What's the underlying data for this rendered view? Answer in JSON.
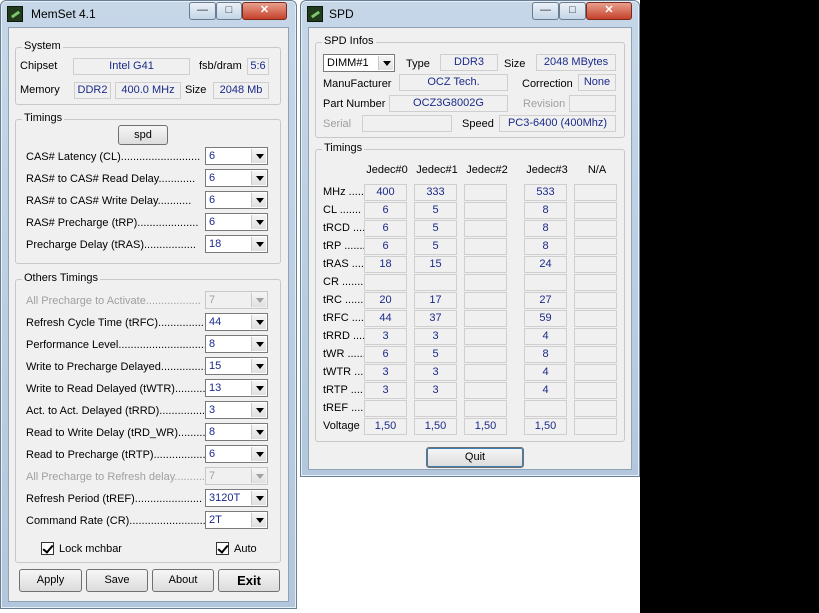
{
  "memset": {
    "title": "MemSet 4.1",
    "buttons": {
      "minimize": "—",
      "maximize": "□",
      "close": "✕"
    },
    "system": {
      "group_label": "System",
      "chipset_label": "Chipset",
      "chipset_value": "Intel G41",
      "fsb_label": "fsb/dram",
      "fsb_value": "5:6",
      "memory_label": "Memory",
      "memory_type": "DDR2",
      "memory_freq": "400.0 MHz",
      "size_label": "Size",
      "size_value": "2048 Mb"
    },
    "timings": {
      "group_label": "Timings",
      "spd_button": "spd",
      "rows": [
        {
          "label": "CAS# Latency (CL)..........................",
          "value": "6"
        },
        {
          "label": "RAS# to CAS# Read Delay............",
          "value": "6"
        },
        {
          "label": "RAS# to CAS# Write Delay...........",
          "value": "6"
        },
        {
          "label": "RAS# Precharge (tRP)....................",
          "value": "6"
        },
        {
          "label": "Precharge Delay  (tRAS).................",
          "value": "18"
        }
      ]
    },
    "others": {
      "group_label": "Others Timings",
      "rows": [
        {
          "label": "All Precharge to Activate..................",
          "value": "7",
          "disabled": true
        },
        {
          "label": "Refresh Cycle Time (tRFC)...............",
          "value": "44",
          "disabled": false
        },
        {
          "label": "Performance Level..............................",
          "value": "8",
          "disabled": false
        },
        {
          "label": "Write to Precharge Delayed...............",
          "value": "15",
          "disabled": false
        },
        {
          "label": "Write to Read Delayed (tWTR)...........",
          "value": "13",
          "disabled": false
        },
        {
          "label": "Act. to Act. Delayed (tRRD)...............",
          "value": "3",
          "disabled": false
        },
        {
          "label": "Read to Write Delay (tRD_WR)...........",
          "value": "8",
          "disabled": false
        },
        {
          "label": "Read to Precharge (tRTP)..................",
          "value": "6",
          "disabled": false
        },
        {
          "label": "All Precharge to Refresh delay............",
          "value": "7",
          "disabled": true
        },
        {
          "label": "Refresh Period (tREF)......................",
          "value": "3120T",
          "disabled": false
        },
        {
          "label": "Command Rate (CR)..........................",
          "value": "2T",
          "disabled": false
        }
      ],
      "lock_label": "Lock mchbar",
      "auto_label": "Auto"
    },
    "footer": {
      "apply": "Apply",
      "save": "Save",
      "about": "About",
      "exit": "Exit"
    }
  },
  "spd": {
    "title": "SPD",
    "buttons": {
      "minimize": "—",
      "maximize": "□",
      "close": "✕"
    },
    "infos": {
      "group_label": "SPD Infos",
      "dimm_value": "DIMM#1",
      "type_label": "Type",
      "type_value": "DDR3",
      "size_label": "Size",
      "size_value": "2048 MBytes",
      "manufacturer_label": "ManuFacturer",
      "manufacturer_value": "OCZ Tech.",
      "correction_label": "Correction",
      "correction_value": "None",
      "part_label": "Part Number",
      "part_value": "OCZ3G8002G",
      "revision_label": "Revision",
      "revision_value": "",
      "serial_label": "Serial",
      "serial_value": "",
      "speed_label": "Speed",
      "speed_value": "PC3-6400 (400Mhz)"
    },
    "timings": {
      "group_label": "Timings",
      "columns": [
        "Jedec#0",
        "Jedec#1",
        "Jedec#2",
        "Jedec#3",
        "N/A"
      ],
      "rows": [
        {
          "label": "MHz .....",
          "values": [
            "400",
            "333",
            "",
            "533",
            ""
          ]
        },
        {
          "label": "CL .......",
          "values": [
            "6",
            "5",
            "",
            "8",
            ""
          ]
        },
        {
          "label": "tRCD .....",
          "values": [
            "6",
            "5",
            "",
            "8",
            ""
          ]
        },
        {
          "label": "tRP .......",
          "values": [
            "6",
            "5",
            "",
            "8",
            ""
          ]
        },
        {
          "label": "tRAS .....",
          "values": [
            "18",
            "15",
            "",
            "24",
            ""
          ]
        },
        {
          "label": "CR .......",
          "values": [
            "",
            "",
            "",
            "",
            ""
          ]
        },
        {
          "label": "tRC .......",
          "values": [
            "20",
            "17",
            "",
            "27",
            ""
          ]
        },
        {
          "label": "tRFC .....",
          "values": [
            "44",
            "37",
            "",
            "59",
            ""
          ]
        },
        {
          "label": "tRRD .....",
          "values": [
            "3",
            "3",
            "",
            "4",
            ""
          ]
        },
        {
          "label": "tWR .......",
          "values": [
            "6",
            "5",
            "",
            "8",
            ""
          ]
        },
        {
          "label": "tWTR .....",
          "values": [
            "3",
            "3",
            "",
            "4",
            ""
          ]
        },
        {
          "label": "tRTP .....",
          "values": [
            "3",
            "3",
            "",
            "4",
            ""
          ]
        },
        {
          "label": "tREF .....",
          "values": [
            "",
            "",
            "",
            "",
            ""
          ]
        },
        {
          "label": "Voltage",
          "values": [
            "1,50",
            "1,50",
            "1,50",
            "1,50",
            ""
          ]
        }
      ],
      "quit_button": "Quit"
    }
  }
}
